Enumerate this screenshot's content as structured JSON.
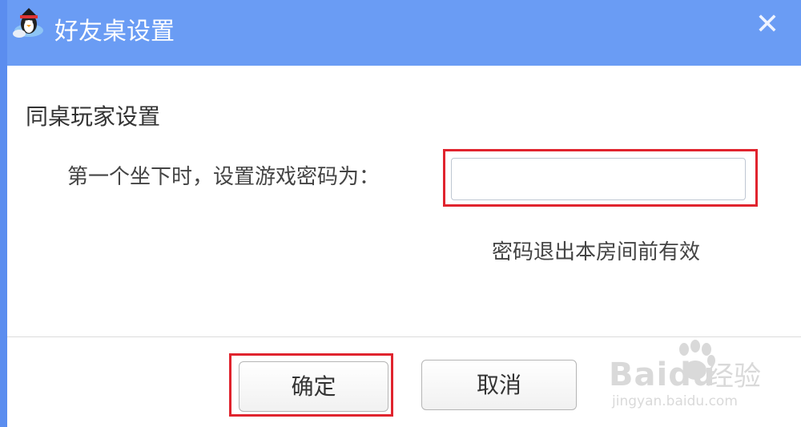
{
  "window": {
    "title": "好友桌设置",
    "close_symbol": "✕",
    "titlebar_color": "#6a9cf4"
  },
  "icons": {
    "app": "qq-penguin-icon",
    "close": "close-icon"
  },
  "section": {
    "title": "同桌玩家设置"
  },
  "password": {
    "label": "第一个坐下时，设置游戏密码为：",
    "value": "",
    "placeholder": ""
  },
  "hint": "密码退出本房间前有效",
  "buttons": {
    "ok_label": "确定",
    "cancel_label": "取消"
  },
  "annotation_color": "#e0242e",
  "watermark": {
    "brand": "Bai",
    "brand_suffix": "du",
    "cn": "经验",
    "url": "jingyan.baidu.com"
  }
}
